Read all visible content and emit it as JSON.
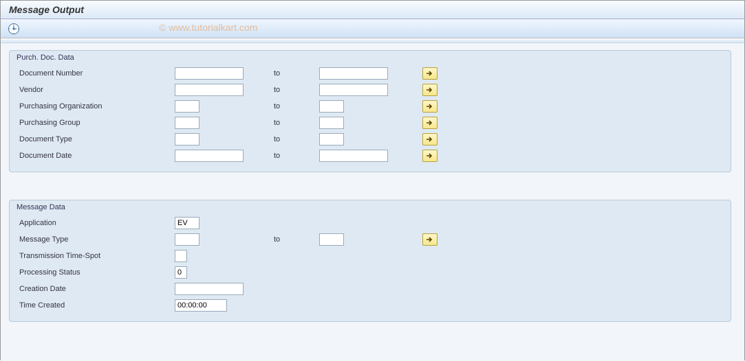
{
  "title": "Message Output",
  "watermark": "© www.tutorialkart.com",
  "group1": {
    "title": "Purch. Doc. Data",
    "to_label": "to",
    "rows": {
      "docnum": {
        "label": "Document Number"
      },
      "vendor": {
        "label": "Vendor"
      },
      "porg": {
        "label": "Purchasing Organization"
      },
      "pgrp": {
        "label": "Purchasing Group"
      },
      "doctype": {
        "label": "Document Type"
      },
      "docdate": {
        "label": "Document Date"
      }
    }
  },
  "group2": {
    "title": "Message Data",
    "to_label": "to",
    "rows": {
      "app": {
        "label": "Application",
        "value": "EV"
      },
      "mtype": {
        "label": "Message Type"
      },
      "tspot": {
        "label": "Transmission Time-Spot"
      },
      "pstat": {
        "label": "Processing Status",
        "value": "0"
      },
      "cdate": {
        "label": "Creation Date"
      },
      "tcreat": {
        "label": "Time Created",
        "value": "00:00:00"
      }
    }
  }
}
